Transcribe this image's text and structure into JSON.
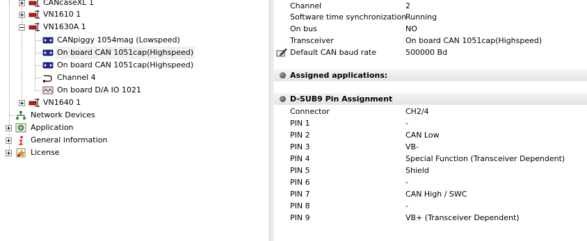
{
  "tree": {
    "nodes": [
      {
        "label": "CANcaseXL 1"
      },
      {
        "label": "VN1610 1"
      },
      {
        "label": "VN1630A 1"
      },
      {
        "label": "CANpiggy 1054mag (Lowspeed)"
      },
      {
        "label": "On board CAN 1051cap(Highspeed)"
      },
      {
        "label": "On board CAN 1051cap(Highspeed)"
      },
      {
        "label": "Channel 4"
      },
      {
        "label": "On board D/A IO 1021"
      },
      {
        "label": "VN1640 1"
      },
      {
        "label": "Network Devices"
      },
      {
        "label": "Application"
      },
      {
        "label": "General information"
      },
      {
        "label": "License"
      }
    ]
  },
  "properties": {
    "rows": [
      {
        "name": "Channel",
        "value": "2"
      },
      {
        "name": "Software time synchronization",
        "value": "Running"
      },
      {
        "name": "On bus",
        "value": "NO"
      },
      {
        "name": "Transceiver",
        "value": "On board CAN 1051cap(Highspeed)"
      },
      {
        "name": "Default CAN baud rate",
        "value": "500000 Bd"
      }
    ],
    "assigned_section": {
      "title": "Assigned applications:"
    },
    "dsub_section": {
      "title": "D-SUB9 Pin Assignment",
      "rows": [
        {
          "name": "Connector",
          "value": "CH2/4"
        },
        {
          "name": "PIN 1",
          "value": "-"
        },
        {
          "name": "PIN 2",
          "value": "CAN Low"
        },
        {
          "name": "PIN 3",
          "value": "VB-"
        },
        {
          "name": "PIN 4",
          "value": "Special Function (Transceiver Dependent)"
        },
        {
          "name": "PIN 5",
          "value": "Shield"
        },
        {
          "name": "PIN 6",
          "value": "-"
        },
        {
          "name": "PIN 7",
          "value": "CAN High / SWC"
        },
        {
          "name": "PIN 8",
          "value": "-"
        },
        {
          "name": "PIN 9",
          "value": "VB+ (Transceiver Dependent)"
        }
      ]
    }
  }
}
